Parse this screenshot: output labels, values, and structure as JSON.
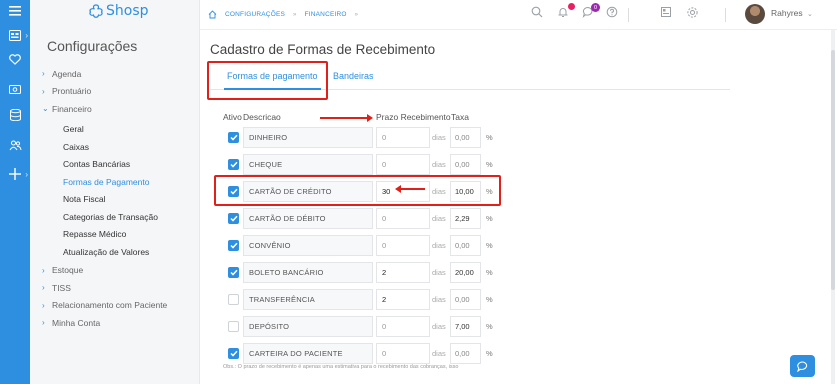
{
  "app": {
    "logo_text": "Shosp"
  },
  "rail": {
    "icons": [
      "menu-icon",
      "dashboard-icon",
      "heart-icon",
      "money-icon",
      "database-icon",
      "users-icon",
      "plus-icon"
    ]
  },
  "sidebar": {
    "title": "Configurações",
    "items": [
      {
        "label": "Agenda",
        "expanded": false
      },
      {
        "label": "Prontuário",
        "expanded": false
      },
      {
        "label": "Financeiro",
        "expanded": true
      }
    ],
    "financeiro_sub": [
      {
        "label": "Geral"
      },
      {
        "label": "Caixas"
      },
      {
        "label": "Contas Bancárias"
      },
      {
        "label": "Formas de Pagamento",
        "active": true
      },
      {
        "label": "Nota Fiscal"
      },
      {
        "label": "Categorias de Transação"
      },
      {
        "label": "Repasse Médico"
      },
      {
        "label": "Atualização de Valores"
      }
    ],
    "items_after": [
      {
        "label": "Estoque"
      },
      {
        "label": "TISS"
      },
      {
        "label": "Relacionamento com Paciente"
      },
      {
        "label": "Minha Conta"
      }
    ]
  },
  "topbar": {
    "breadcrumb": [
      "CONFIGURAÇÕES",
      "FINANCEIRO"
    ],
    "notifications_badge": "",
    "messages_badge": "0",
    "user_name": "Rahyres",
    "badge_colors": {
      "notifications": "#e91e63",
      "messages": "#9c27b0"
    }
  },
  "page": {
    "title": "Cadastro de Formas de Recebimento",
    "tabs": [
      {
        "label": "Formas de pagamento",
        "active": true
      },
      {
        "label": "Bandeiras",
        "active": false
      }
    ],
    "columns": {
      "ativo": "Ativo",
      "descricao": "Descricao",
      "prazo": "Prazo Recebimento",
      "taxa": "Taxa"
    },
    "rows": [
      {
        "ativo": true,
        "descricao": "DINHEIRO",
        "prazo": "0",
        "dias": "dias",
        "taxa": "0,00",
        "pct": "%"
      },
      {
        "ativo": true,
        "descricao": "CHEQUE",
        "prazo": "0",
        "dias": "dias",
        "taxa": "0,00",
        "pct": "%"
      },
      {
        "ativo": true,
        "descricao": "CARTÃO DE CRÉDITO",
        "prazo": "30",
        "dias": "dias",
        "taxa": "10,00",
        "pct": "%"
      },
      {
        "ativo": true,
        "descricao": "CARTÃO DE DÉBITO",
        "prazo": "0",
        "dias": "dias",
        "taxa": "2,29",
        "pct": "%"
      },
      {
        "ativo": true,
        "descricao": "CONVÊNIO",
        "prazo": "0",
        "dias": "dias",
        "taxa": "0,00",
        "pct": "%"
      },
      {
        "ativo": true,
        "descricao": "BOLETO BANCÁRIO",
        "prazo": "2",
        "dias": "dias",
        "taxa": "20,00",
        "pct": "%"
      },
      {
        "ativo": false,
        "descricao": "TRANSFERÊNCIA",
        "prazo": "2",
        "dias": "dias",
        "taxa": "0,00",
        "pct": "%"
      },
      {
        "ativo": false,
        "descricao": "DEPÓSITO",
        "prazo": "0",
        "dias": "dias",
        "taxa": "7,00",
        "pct": "%"
      },
      {
        "ativo": true,
        "descricao": "CARTEIRA DO PACIENTE",
        "prazo": "0",
        "dias": "dias",
        "taxa": "0,00",
        "pct": "%"
      }
    ],
    "note": "Obs.: O prazo de recebimento é apenas uma estimativa para o recebimento das cobranças, isso"
  },
  "colors": {
    "accent": "#2e8fe0",
    "annotation": "#e0201a",
    "rail": "#2e8fe0"
  }
}
